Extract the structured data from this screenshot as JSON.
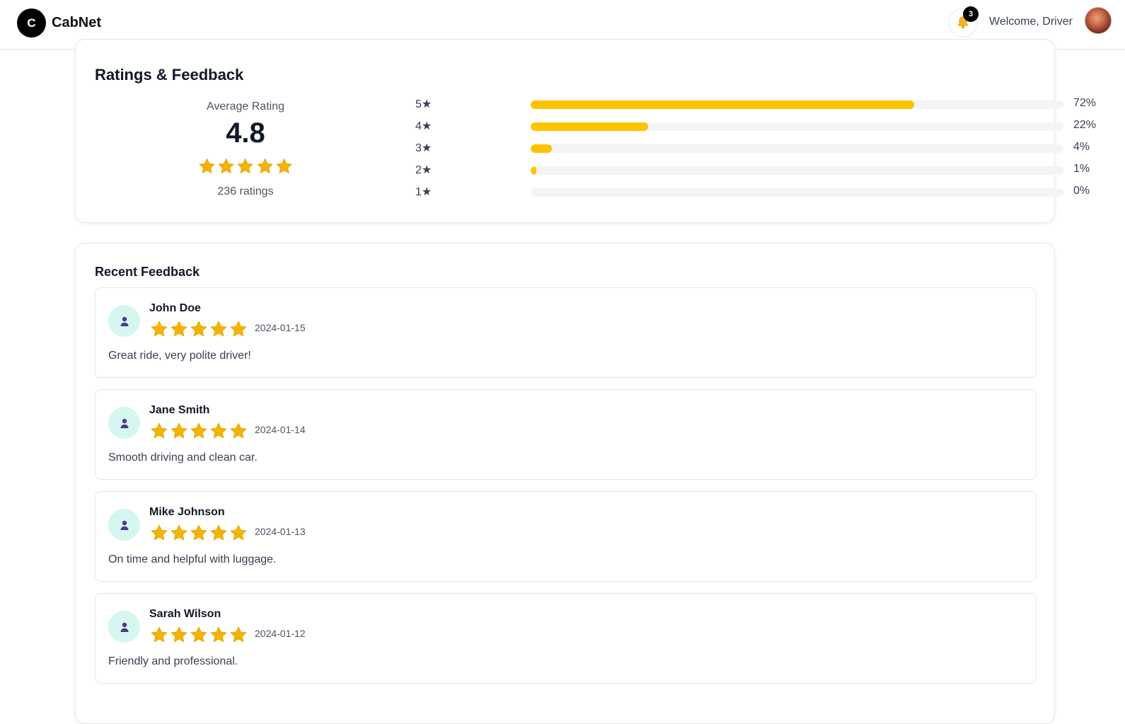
{
  "header": {
    "logo_letter": "C",
    "brand": "CabNet",
    "notification_count": "3",
    "welcome": "Welcome, Driver"
  },
  "ratings": {
    "title": "Ratings & Feedback",
    "average_label": "Average Rating",
    "average_value": "4.8",
    "stars_shown": 5,
    "count_text": "236 ratings",
    "distribution": [
      {
        "label": "5★",
        "percent": 72,
        "percent_text": "72%"
      },
      {
        "label": "4★",
        "percent": 22,
        "percent_text": "22%"
      },
      {
        "label": "3★",
        "percent": 4,
        "percent_text": "4%"
      },
      {
        "label": "2★",
        "percent": 1,
        "percent_text": "1%"
      },
      {
        "label": "1★",
        "percent": 0,
        "percent_text": "0%"
      }
    ]
  },
  "feedback": {
    "title": "Recent Feedback",
    "items": [
      {
        "name": "John Doe",
        "stars": 5,
        "date": "2024-01-15",
        "comment": "Great ride, very polite driver!"
      },
      {
        "name": "Jane Smith",
        "stars": 5,
        "date": "2024-01-14",
        "comment": "Smooth driving and clean car."
      },
      {
        "name": "Mike Johnson",
        "stars": 5,
        "date": "2024-01-13",
        "comment": "On time and helpful with luggage."
      },
      {
        "name": "Sarah Wilson",
        "stars": 5,
        "date": "2024-01-12",
        "comment": "Friendly and professional."
      }
    ]
  },
  "colors": {
    "accent_yellow": "#fcc400",
    "star_fill": "#f5b301",
    "avatar_bg": "#d5f7f0",
    "avatar_icon": "#4b3a8c"
  },
  "icons": {
    "bell": "bell-icon",
    "star": "star-icon",
    "user": "user-icon"
  }
}
